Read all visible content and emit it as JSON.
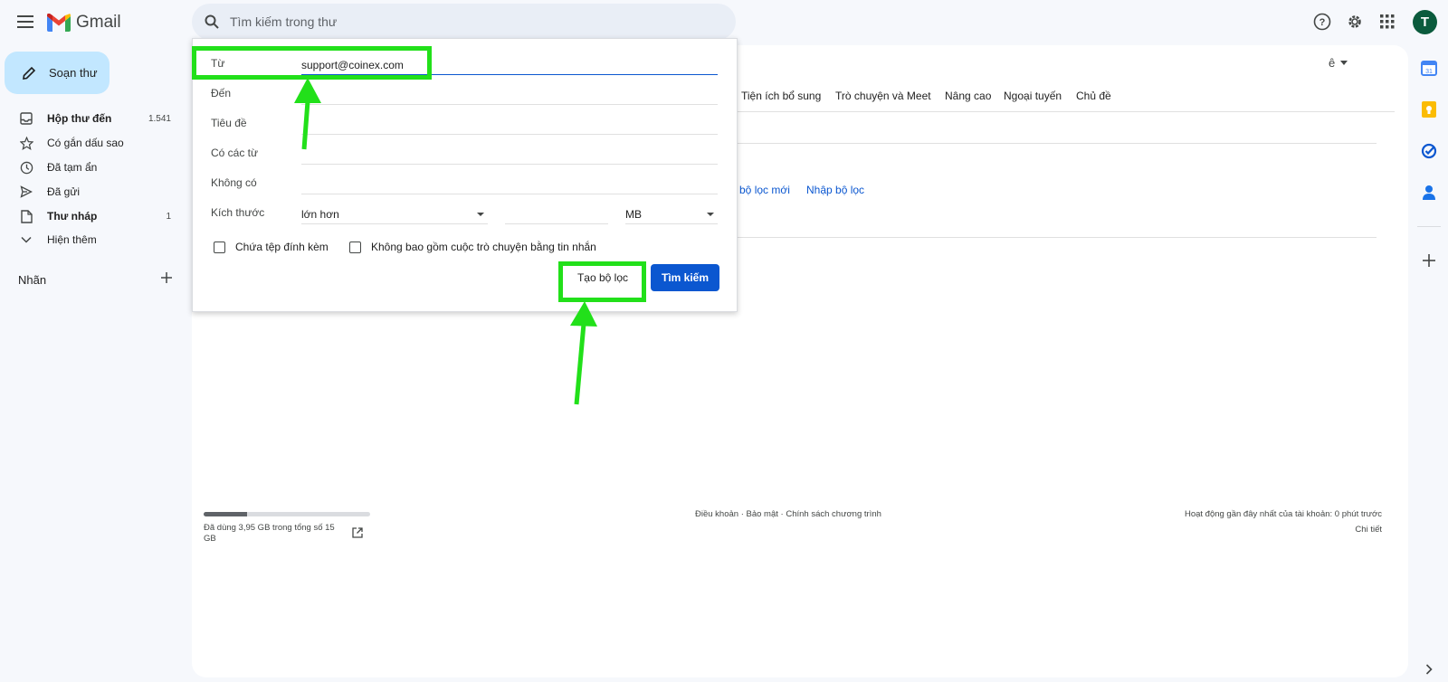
{
  "header": {
    "logo_text": "Gmail",
    "search_placeholder": "Tìm kiếm trong thư",
    "avatar_initial": "T"
  },
  "nav": {
    "compose_label": "Soạn thư",
    "items": [
      {
        "label": "Hộp thư đến",
        "count": "1.541",
        "icon": "inbox-icon",
        "bold": true
      },
      {
        "label": "Có gắn dấu sao",
        "count": "",
        "icon": "star-icon",
        "bold": false
      },
      {
        "label": "Đã tạm ẩn",
        "count": "",
        "icon": "clock-icon",
        "bold": false
      },
      {
        "label": "Đã gửi",
        "count": "",
        "icon": "send-icon",
        "bold": false
      },
      {
        "label": "Thư nháp",
        "count": "1",
        "icon": "draft-icon",
        "bold": true
      },
      {
        "label": "Hiện thêm",
        "count": "",
        "icon": "chevron-down-icon",
        "bold": false
      }
    ],
    "labels_title": "Nhãn"
  },
  "settings_tabs": [
    "Tiện ích bổ sung",
    "Trò chuyện và Meet",
    "Nâng cao",
    "Ngoại tuyến",
    "Chủ đề"
  ],
  "lang_btn": "ê",
  "filter_links": {
    "create_filter": "o bộ lọc mới",
    "import_filter": "Nhập bộ lọc"
  },
  "advanced_search": {
    "from_label": "Từ",
    "from_value": "support@coinex.com",
    "to_label": "Đến",
    "subject_label": "Tiêu đề",
    "has_words_label": "Có các từ",
    "doesnt_have_label": "Không có",
    "size_label": "Kích thước",
    "size_operator": "lớn hơn",
    "size_unit": "MB",
    "has_attachment_label": "Chứa tệp đính kèm",
    "exclude_chats_label": "Không bao gồm cuộc trò chuyện bằng tin nhắn",
    "create_filter_button": "Tạo bộ lọc",
    "search_button": "Tìm kiếm"
  },
  "footer": {
    "storage_text": "Đã dùng 3,95 GB trong tổng số 15 GB",
    "storage_fraction": 0.26,
    "links": [
      "Điều khoản",
      "Bảo mật",
      "Chính sách chương trình"
    ],
    "activity": "Hoạt động gần đây nhất của tài khoản: 0 phút trước",
    "details": "Chi tiết"
  },
  "colors": {
    "highlight": "#22e01a",
    "primary": "#0b57d0",
    "compose_bg": "#c2e7ff"
  }
}
